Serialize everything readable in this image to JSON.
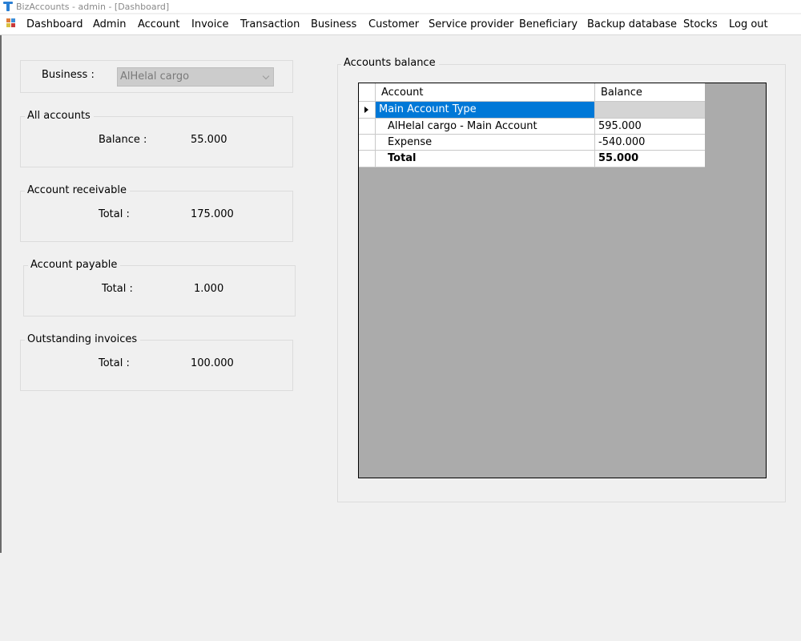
{
  "window": {
    "title": "BizAccounts - admin - [Dashboard]"
  },
  "menu": {
    "items": [
      "Dashboard",
      "Admin",
      "Account",
      "Invoice",
      "Transaction",
      "Business",
      "Customer",
      "Service provider",
      "Beneficiary",
      "Backup database",
      "Stocks",
      "Log out"
    ]
  },
  "business_filter": {
    "label": "Business :",
    "selected": "AlHelal cargo"
  },
  "all_accounts": {
    "title": "All accounts",
    "label": "Balance :",
    "value": "55.000"
  },
  "receivable": {
    "title": "Account receivable",
    "label": "Total :",
    "value": "175.000"
  },
  "payable": {
    "title": "Account payable",
    "label": "Total :",
    "value": "1.000"
  },
  "outstanding": {
    "title": "Outstanding invoices",
    "label": "Total :",
    "value": "100.000"
  },
  "accounts_balance": {
    "title": "Accounts balance",
    "columns": [
      "Account",
      "Balance"
    ],
    "rows": [
      {
        "account": "Main Account Type",
        "balance": ""
      },
      {
        "account": "AlHelal cargo - Main Account",
        "balance": "595.000"
      },
      {
        "account": "Expense",
        "balance": "-540.000"
      },
      {
        "account": "Total",
        "balance": "55.000"
      }
    ]
  },
  "colors": {
    "selection": "#0078d7",
    "grid_background": "#ababab",
    "form_background": "#f0f0f0"
  }
}
